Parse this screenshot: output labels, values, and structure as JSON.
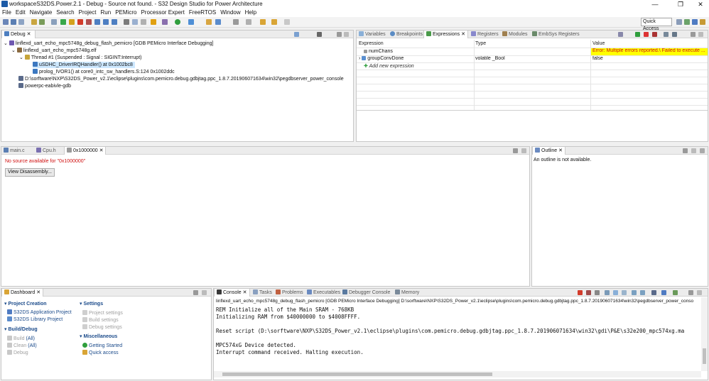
{
  "window": {
    "title": "workspaceS32DS.Power.2.1 - Debug - Source not found. - S32 Design Studio for Power Architecture",
    "min": "—",
    "max": "❐",
    "close": "✕"
  },
  "menu": [
    "File",
    "Edit",
    "Navigate",
    "Search",
    "Project",
    "Run",
    "PEMicro",
    "Processor Expert",
    "FreeRTOS",
    "Window",
    "Help"
  ],
  "quick_access": "Quick Access",
  "debug": {
    "tab": "Debug",
    "items": [
      {
        "text": "linflexd_uart_echo_mpc5748g_debug_flash_pemicro [GDB PEMicro Interface Debugging]",
        "level": 0
      },
      {
        "text": "linflexd_uart_echo_mpc5748g.elf",
        "level": 1
      },
      {
        "text": "Thread #1 (Suspended : Signal : SIGINT:Interrupt)",
        "level": 2
      },
      {
        "text": "uSDHC_DriverIRQHandler() at 0x1002bc8",
        "level": 3
      },
      {
        "text": "prolog_IVOR1() at core0_intc_sw_handlers.S:124 0x1002ddc",
        "level": 3
      },
      {
        "text": "D:\\sorftware\\NXP\\S32DS_Power_v2.1\\eclipse\\plugins\\com.pemicro.debug.gdbjtag.ppc_1.8.7.201906071634\\win32\\pegdbserver_power_console",
        "level": 1
      },
      {
        "text": "powerpc-eabivle-gdb",
        "level": 1
      }
    ]
  },
  "expressions": {
    "tabs": [
      "Variables",
      "Breakpoints",
      "Expressions",
      "Registers",
      "Modules",
      "EmbSys Registers"
    ],
    "columns": [
      "Expression",
      "Type",
      "Value"
    ],
    "rows": [
      {
        "expr": "numChans",
        "type": "",
        "value": "Error: Multiple errors reported.\\ Failed to execute ..."
      },
      {
        "expr": "groupConvDone",
        "type": "volatile _Bool",
        "value": "false"
      },
      {
        "expr": "Add new expression",
        "type": "",
        "value": ""
      }
    ],
    "error_color": "#ffff00"
  },
  "editor": {
    "tabs": [
      "main.c",
      "Cpu.h",
      "0x1000000"
    ],
    "message": "No source available for \"0x1000000\"",
    "button": "View Disassembly..."
  },
  "outline": {
    "tab": "Outline",
    "message": "An outline is not available."
  },
  "dashboard": {
    "tab": "Dashboard",
    "groups": [
      {
        "title": "Project Creation",
        "items": [
          {
            "label": "S32DS Application Project",
            "enabled": true
          },
          {
            "label": "S32DS Library Project",
            "enabled": true
          }
        ]
      },
      {
        "title": "Build/Debug",
        "items": [
          {
            "label": "Build",
            "suffix": "(All)",
            "enabled": false
          },
          {
            "label": "Clean",
            "suffix": "(All)",
            "enabled": false
          },
          {
            "label": "Debug",
            "suffix": "",
            "enabled": false
          }
        ]
      },
      {
        "title": "Settings",
        "items": [
          {
            "label": "Project settings",
            "enabled": false
          },
          {
            "label": "Build settings",
            "enabled": false
          },
          {
            "label": "Debug settings",
            "enabled": false
          }
        ]
      },
      {
        "title": "Miscellaneous",
        "items": [
          {
            "label": "Getting Started",
            "enabled": true
          },
          {
            "label": "Quick access",
            "enabled": true
          }
        ]
      }
    ]
  },
  "console": {
    "tabs": [
      "Console",
      "Tasks",
      "Problems",
      "Executables",
      "Debugger Console",
      "Memory"
    ],
    "header": "linflexd_uart_echo_mpc5748g_debug_flash_pemicro [GDB PEMicro Interface Debugging] D:\\sorftware\\NXP\\S32DS_Power_v2.1\\eclipse\\plugins\\com.pemicro.debug.gdbjtag.ppc_1.8.7.201906071634\\win32\\pegdbserver_power_conso",
    "lines": [
      "REM Initialize all of the Main SRAM - 768KB",
      "Initializing RAM from $40000000 to $4008FFFF.",
      "",
      "Reset script (D:\\sorftware\\NXP\\S32DS_Power_v2.1\\eclipse\\plugins\\com.pemicro.debug.gdbjtag.ppc_1.8.7.201906071634\\win32\\gdi\\P&E\\s32e200_mpc574xg.ma",
      "",
      "MPC574xG Device detected.",
      "Interrupt command received. Halting execution."
    ]
  }
}
